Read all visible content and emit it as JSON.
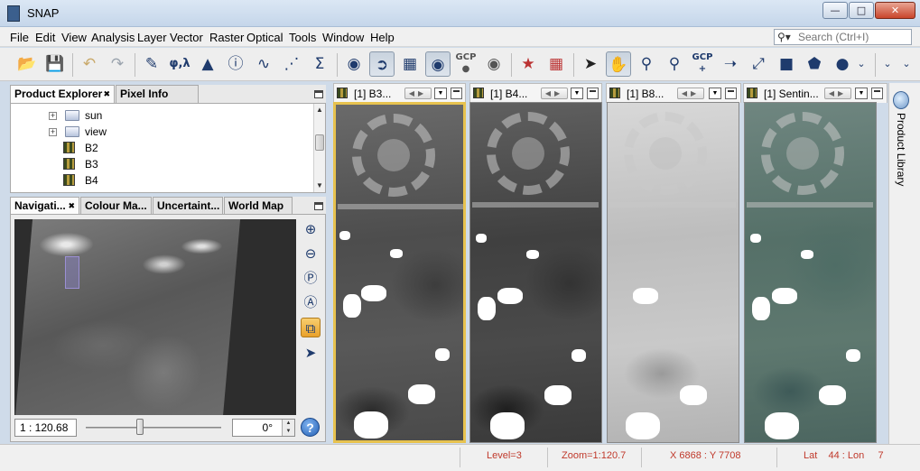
{
  "window": {
    "title": "SNAP"
  },
  "menu": [
    "File",
    "Edit",
    "View",
    "Analysis",
    "Layer",
    "Vector",
    "Raster",
    "Optical",
    "Tools",
    "Window",
    "Help"
  ],
  "search": {
    "placeholder": "Search (Ctrl+I)"
  },
  "toolbar": {
    "gcp_label": "GCP",
    "gcp_tool_label": "GCP"
  },
  "product_explorer": {
    "tabs": [
      "Product Explorer",
      "Pixel Info"
    ],
    "tree": [
      {
        "label": "sun",
        "type": "folder"
      },
      {
        "label": "view",
        "type": "folder"
      },
      {
        "label": "B2",
        "type": "band"
      },
      {
        "label": "B3",
        "type": "band"
      },
      {
        "label": "B4",
        "type": "band"
      }
    ]
  },
  "navigation": {
    "tabs": [
      "Navigati...",
      "Colour Ma...",
      "Uncertaint...",
      "World Map"
    ],
    "zoom_value": "1 : 120.68",
    "rotation_value": "0°"
  },
  "image_views": [
    {
      "label": "[1] B3..."
    },
    {
      "label": "[1] B4..."
    },
    {
      "label": "[1] B8..."
    },
    {
      "label": "[1] Sentin..."
    }
  ],
  "side_panel": {
    "label": "Product Library"
  },
  "status": {
    "level": "Level=3",
    "zoom": "Zoom=1:120.7",
    "xy": "X  6868 : Y  7708",
    "latlon": "Lat    44 : Lon     7"
  },
  "colors": {
    "accent_selected_view": "#e7c24f",
    "status_text": "#c0392b"
  }
}
